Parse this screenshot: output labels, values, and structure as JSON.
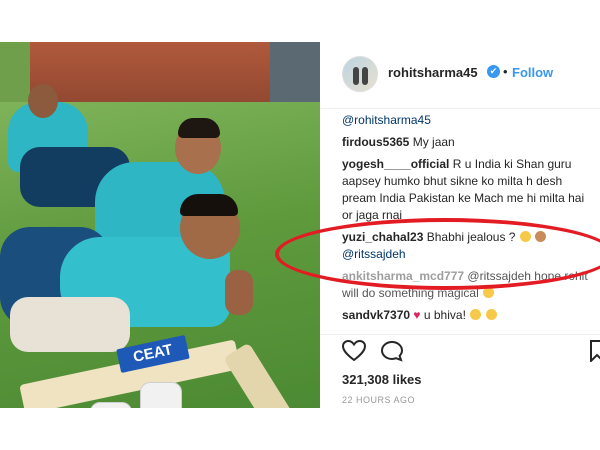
{
  "header": {
    "username": "rohitsharma45",
    "verified_badge": "✔",
    "separator": "•",
    "follow_label": "Follow"
  },
  "photo": {
    "bat_brand": "CEAT"
  },
  "comments": [
    {
      "user": "",
      "text": "@rohitsharma45",
      "style": "mention"
    },
    {
      "user": "firdous5365",
      "text": "My jaan"
    },
    {
      "user": "yogesh____official",
      "text": "R u India ki Shan guru aapsey humko bhut sikne ko milta h desh pream India Pakistan ke Mach me hi milta hai or jaga rnai"
    },
    {
      "user": "yuzi_chahal23",
      "text": "Bhabhi jealous ?",
      "mention": "@ritssajdeh"
    },
    {
      "user": "ankitsharma_mcd777",
      "text": "@ritssajdeh hope rohit will do something magical",
      "style": "faded"
    },
    {
      "user": "sandvk7370",
      "text": "u bhiva!"
    }
  ],
  "actions": {
    "like_icon": "heart-icon",
    "comment_icon": "comment-icon",
    "save_icon": "bookmark-icon"
  },
  "likes_text": "321,308 likes",
  "timestamp": "22 HOURS AGO",
  "colors": {
    "link_blue": "#3897f0",
    "highlight_red": "#e31b23"
  }
}
